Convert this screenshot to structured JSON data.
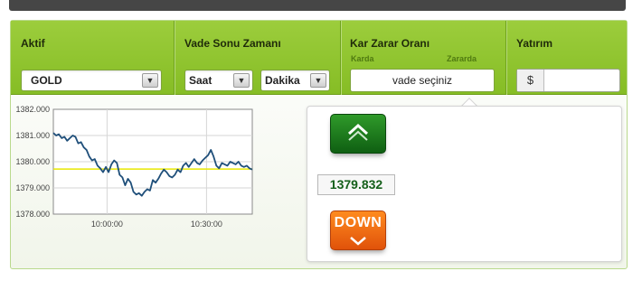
{
  "header": {
    "aktif_label": "Aktif",
    "asset_value": "GOLD",
    "vade_label": "Vade Sonu Zamanı",
    "saat_value": "Saat",
    "dakika_value": "Dakika",
    "kar_label": "Kar Zarar Oranı",
    "karda_label": "Karda",
    "zararda_label": "Zararda",
    "vade_select_text": "vade seçiniz",
    "yatirim_label": "Yatırım",
    "currency_symbol": "$",
    "amount_value": ""
  },
  "trade": {
    "price": "1379.832",
    "down_label": "DOWN"
  },
  "colors": {
    "accent_green": "#86bd25",
    "up_button": "#1a7a1c",
    "down_button": "#f26a10",
    "line": "#1f4f7a",
    "strike_line": "#e8e800"
  },
  "chart_data": {
    "type": "line",
    "ylim": [
      1378.0,
      1382.0
    ],
    "y_ticks": [
      "1382.000",
      "1381.000",
      "1380.000",
      "1379.000",
      "1378.000"
    ],
    "x_ticks": [
      "10:00:00",
      "10:30:00"
    ],
    "grid": true,
    "strike_value": 1379.72,
    "series": [
      {
        "values": [
          1381.1,
          1381.0,
          1381.05,
          1380.9,
          1380.95,
          1380.8,
          1380.9,
          1381.0,
          1380.95,
          1380.7,
          1380.75,
          1380.55,
          1380.45,
          1380.2,
          1380.05,
          1380.1,
          1379.85,
          1379.75,
          1379.6,
          1379.8,
          1379.6,
          1379.9,
          1380.05,
          1379.95,
          1379.5,
          1379.4,
          1379.1,
          1379.35,
          1379.2,
          1378.85,
          1378.75,
          1378.8,
          1378.7,
          1378.85,
          1378.95,
          1378.9,
          1379.3,
          1379.2,
          1379.35,
          1379.55,
          1379.7,
          1379.6,
          1379.45,
          1379.4,
          1379.5,
          1379.7,
          1379.6,
          1379.85,
          1379.95,
          1379.8,
          1379.95,
          1380.1,
          1379.95,
          1379.9,
          1380.05,
          1380.15,
          1380.25,
          1380.45,
          1380.2,
          1379.85,
          1379.75,
          1379.95,
          1379.9,
          1379.85,
          1380.0,
          1379.95,
          1379.9,
          1380.0,
          1379.85,
          1379.8,
          1379.85,
          1379.75,
          1379.7
        ]
      }
    ]
  }
}
